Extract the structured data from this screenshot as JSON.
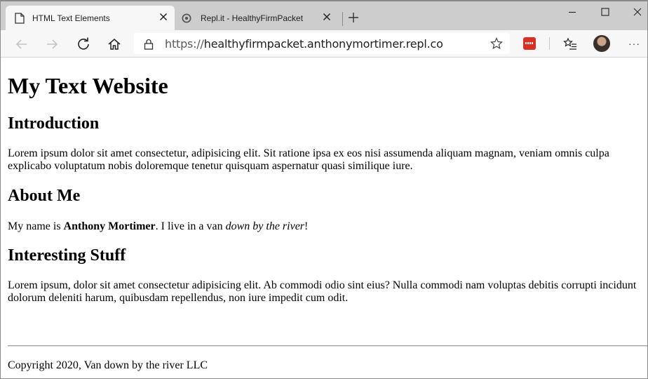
{
  "browser": {
    "tabs": [
      {
        "title": "HTML Text Elements",
        "active": true,
        "icon": "page-icon"
      },
      {
        "title": "Repl.it - HealthyFirmPacket",
        "active": false,
        "icon": "replit-icon"
      }
    ],
    "url_scheme": "https://",
    "url_rest": "healthyfirmpacket.anthonymortimer.repl.co"
  },
  "page": {
    "h1": "My Text Website",
    "sections": [
      {
        "heading": "Introduction",
        "text": "Lorem ipsum dolor sit amet consectetur, adipisicing elit. Sit ratione ipsa ex eos nisi assumenda aliquam magnam, veniam omnis culpa explicabo voluptatum nobis doloremque tenetur quisquam aspernatur quasi similique iure."
      },
      {
        "heading": "About Me",
        "text_before": "My name is ",
        "bold": "Anthony Mortimer",
        "text_middle": ". I live in a van ",
        "italic": "down by the river",
        "text_after": "!"
      },
      {
        "heading": "Interesting Stuff",
        "text": "Lorem ipsum, dolor sit amet consectetur adipisicing elit. Ab commodi odio sint eius? Nulla commodi nam voluptas debitis corrupti incidunt dolorum deleniti harum, quibusdam repellendus, non iure impedit cum odit."
      }
    ],
    "footer": "Copyright 2020, Van down by the river LLC"
  },
  "colors": {
    "tabstrip": "#cdcdcd",
    "toolbar": "#f7f7f7",
    "extension": "#d93025"
  }
}
